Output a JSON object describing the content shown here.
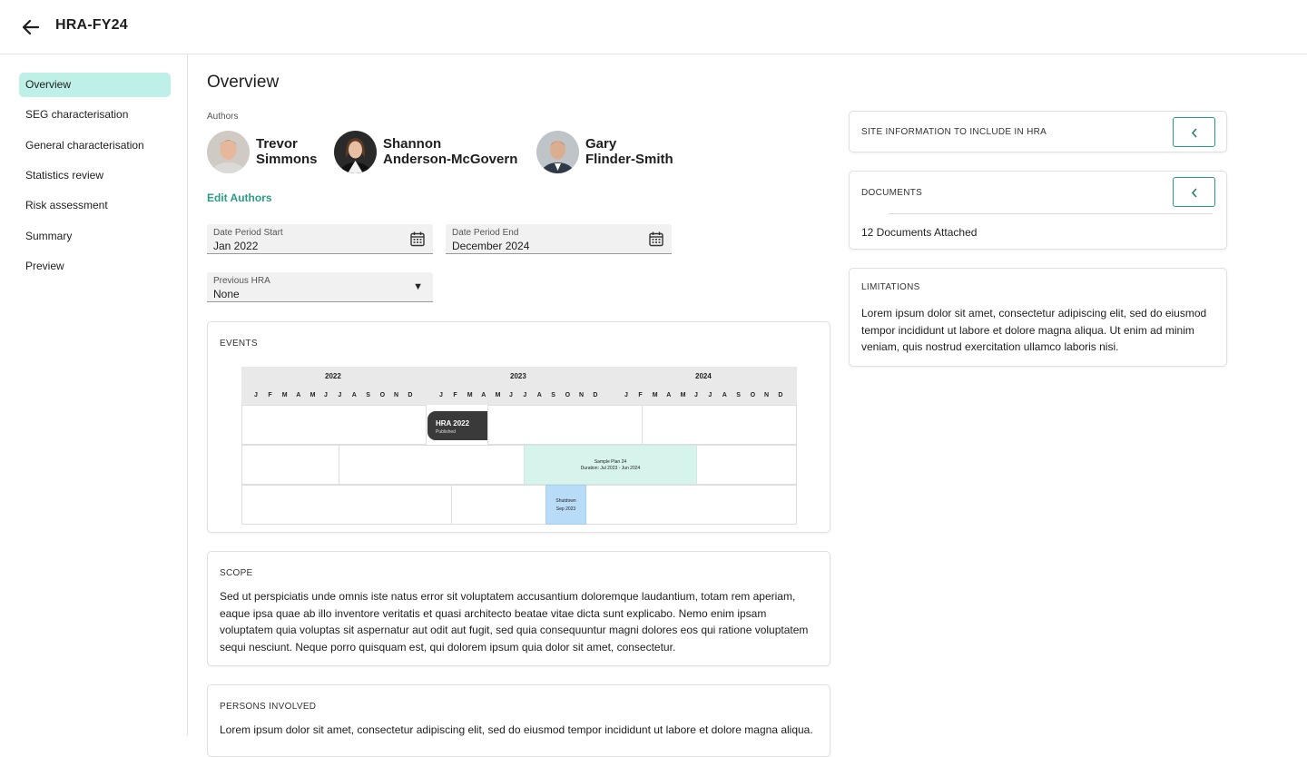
{
  "header": {
    "title": "HRA-FY24"
  },
  "sidebar": {
    "items": [
      {
        "label": "Overview",
        "active": true
      },
      {
        "label": "SEG characterisation"
      },
      {
        "label": "General characterisation"
      },
      {
        "label": "Statistics review"
      },
      {
        "label": "Risk assessment"
      },
      {
        "label": "Summary"
      },
      {
        "label": "Preview"
      }
    ]
  },
  "main": {
    "title": "Overview",
    "authors_label": "Authors",
    "authors": [
      {
        "first": "Trevor",
        "last": "Simmons"
      },
      {
        "first": "Shannon",
        "last": "Anderson-McGovern"
      },
      {
        "first": "Gary",
        "last": "Flinder-Smith"
      }
    ],
    "edit_authors": "Edit Authors",
    "date_start": {
      "label": "Date Period Start",
      "value": "Jan 2022"
    },
    "date_end": {
      "label": "Date Period End",
      "value": "December 2024"
    },
    "previous_hra": {
      "label": "Previous HRA",
      "value": "None"
    },
    "events": {
      "title": "EVENTS",
      "years": [
        "2022",
        "2023",
        "2024"
      ],
      "months": [
        "J",
        "F",
        "M",
        "A",
        "M",
        "J",
        "J",
        "A",
        "S",
        "O",
        "N",
        "D"
      ],
      "items": [
        {
          "title": "HRA 2022",
          "subtitle": "Published"
        },
        {
          "title": "Sample Plan 24",
          "subtitle": "Duration: Jul 2023 - Jun 2024"
        },
        {
          "title": "Shutdown",
          "subtitle": "Sep 2023"
        }
      ]
    },
    "scope": {
      "title": "SCOPE",
      "text": "Sed ut perspiciatis unde omnis iste natus error sit voluptatem accusantium doloremque laudantium, totam rem aperiam, eaque ipsa quae ab illo inventore veritatis et quasi architecto beatae vitae dicta sunt explicabo. Nemo enim ipsam voluptatem quia voluptas sit aspernatur aut odit aut fugit, sed quia consequuntur magni dolores eos qui ratione voluptatem sequi nesciunt. Neque porro quisquam est, qui dolorem ipsum quia dolor sit amet, consectetur."
    },
    "persons": {
      "title": "PERSONS INVOLVED",
      "text": "Lorem ipsum dolor sit amet, consectetur adipiscing elit, sed do eiusmod tempor incididunt ut labore et dolore magna aliqua."
    }
  },
  "right": {
    "site_info": {
      "title": "SITE INFORMATION TO INCLUDE IN HRA"
    },
    "documents": {
      "title": "DOCUMENTS",
      "count_text": "12 Documents Attached"
    },
    "limitations": {
      "title": "LIMITATIONS",
      "text": "Lorem ipsum dolor sit amet, consectetur adipiscing elit, sed do eiusmod tempor incididunt ut labore et dolore magna aliqua. Ut enim ad minim veniam, quis nostrud exercitation ullamco laboris nisi."
    }
  },
  "colors": {
    "accent": "#2a9b86",
    "active_nav": "#bff0e8",
    "event_dark": "#3a3a3a",
    "event_plan": "#d6f3ec",
    "event_shutdown": "#b8dcf7"
  },
  "icons": [
    "back-arrow-icon",
    "calendar-icon",
    "dropdown-caret-icon",
    "chevron-left-icon",
    "avatar-photo"
  ]
}
